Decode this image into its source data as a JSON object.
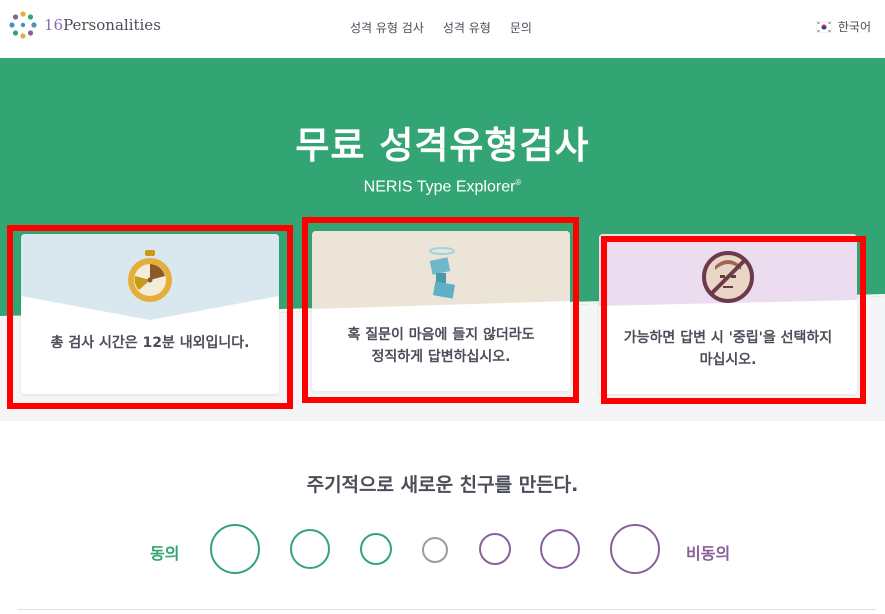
{
  "header": {
    "logo_number": "16",
    "logo_word": "Personalities",
    "nav": [
      "성격 유형 검사",
      "성격 유형",
      "문의"
    ],
    "language": "한국어"
  },
  "hero": {
    "title": "무료 성격유형검사",
    "subtitle": "NERIS Type Explorer",
    "subtitle_mark": "®"
  },
  "cards": [
    {
      "icon": "stopwatch-icon",
      "text": "총 검사 시간은 12분 내외입니다.",
      "accent": "#d9e8ee"
    },
    {
      "icon": "honest-figure-icon",
      "text_line1": "혹 질문이 마음에 들지 않더라도",
      "text_line2": "정직하게 답변하십시오.",
      "accent": "#ece4d6"
    },
    {
      "icon": "no-neutral-icon",
      "text_line1": "가능하면 답변 시 '중립'을 선택하지",
      "text_line2": "마십시오.",
      "accent": "#ebdcf0"
    }
  ],
  "question": {
    "text": "주기적으로 새로운 친구를 만든다.",
    "agree_label": "동의",
    "disagree_label": "비동의",
    "options": 7
  },
  "colors": {
    "primary_green": "#33a474",
    "purple": "#88619a",
    "highlight_red": "#ff0000"
  }
}
